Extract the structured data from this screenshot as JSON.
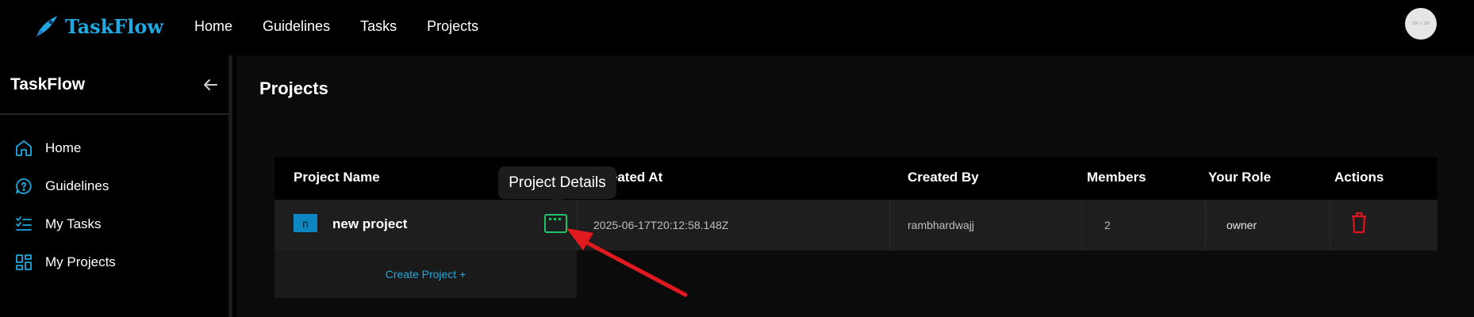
{
  "navbar": {
    "brand": "TaskFlow",
    "links": [
      "Home",
      "Guidelines",
      "Tasks",
      "Projects"
    ],
    "avatar_text": "100 × 100"
  },
  "sidebar": {
    "title": "TaskFlow",
    "back_icon": "arrow-left-icon",
    "items": [
      {
        "label": "Home",
        "icon": "home-icon"
      },
      {
        "label": "Guidelines",
        "icon": "chat-help-icon"
      },
      {
        "label": "My Tasks",
        "icon": "checklist-icon"
      },
      {
        "label": "My Projects",
        "icon": "grid-icon"
      }
    ]
  },
  "main": {
    "title": "Projects",
    "columns": [
      "Project Name",
      "Created At",
      "Created By",
      "Members",
      "Your Role",
      "Actions"
    ],
    "rows": [
      {
        "initial": "n",
        "name": "new project",
        "created_at": "2025-06-17T20:12:58.148Z",
        "created_by": "rambhardwajj",
        "members": "2",
        "role": "owner"
      }
    ],
    "create_label": "Create Project +",
    "tooltip": "Project Details"
  },
  "colors": {
    "brand": "#1fa9e0",
    "details_button": "#1ec26a",
    "delete_icon": "#e0141e",
    "annotation_arrow": "#e0191e"
  }
}
